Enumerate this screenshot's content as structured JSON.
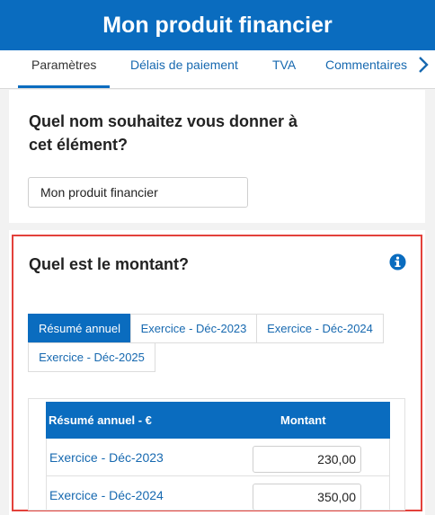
{
  "header": {
    "title": "Mon produit financier"
  },
  "tabs": [
    {
      "label": "Paramètres",
      "active": true
    },
    {
      "label": "Délais de paiement",
      "active": false
    },
    {
      "label": "TVA",
      "active": false
    },
    {
      "label": "Commentaires",
      "active": false
    }
  ],
  "name_section": {
    "question": "Quel nom souhaitez vous donner à cet élément?",
    "value": "Mon produit financier"
  },
  "amount_section": {
    "question": "Quel est le montant?",
    "info_icon": "info-circle-icon",
    "period_tabs": [
      {
        "label": "Résumé annuel",
        "active": true
      },
      {
        "label": "Exercice - Déc-2023",
        "active": false
      },
      {
        "label": "Exercice - Déc-2024",
        "active": false
      },
      {
        "label": "Exercice - Déc-2025",
        "active": false
      }
    ],
    "table": {
      "columns": [
        "Résumé annuel - €",
        "Montant"
      ],
      "rows": [
        {
          "label": "Exercice - Déc-2023",
          "amount": "230,00"
        },
        {
          "label": "Exercice - Déc-2024",
          "amount": "350,00"
        }
      ]
    }
  },
  "colors": {
    "primary": "#0a6cbf",
    "link": "#1769b0",
    "highlight": "#e3413b"
  }
}
